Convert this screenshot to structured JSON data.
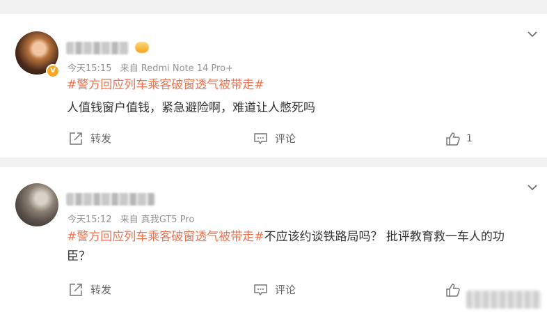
{
  "comments": [
    {
      "time": "今天15:15",
      "source": "来自 Redmi Note 14 Pro+",
      "topic": "#警方回应列车乘客破窗透气被带走#",
      "text": "人值钱窗户值钱，紧急避险啊，难道让人憋死吗",
      "repost_label": "转发",
      "comment_label": "评论",
      "like_count": "1"
    },
    {
      "time": "今天15:12",
      "source": "来自 真我GT5 Pro",
      "topic": "#警方回应列车乘客破窗透气被带走#",
      "text": "不应该约谈铁路局吗？ 批评教育救一车人的功臣？",
      "repost_label": "转发",
      "comment_label": "评论",
      "like_count": ""
    }
  ],
  "icons": {
    "expand": "chevron-down-icon",
    "repost": "repost-icon",
    "comment": "comment-icon",
    "like": "thumbs-up-icon",
    "verified": "verified-badge-icon"
  },
  "colors": {
    "topic": "#eb7350",
    "meta": "#939393",
    "verified": "#f5a623"
  }
}
